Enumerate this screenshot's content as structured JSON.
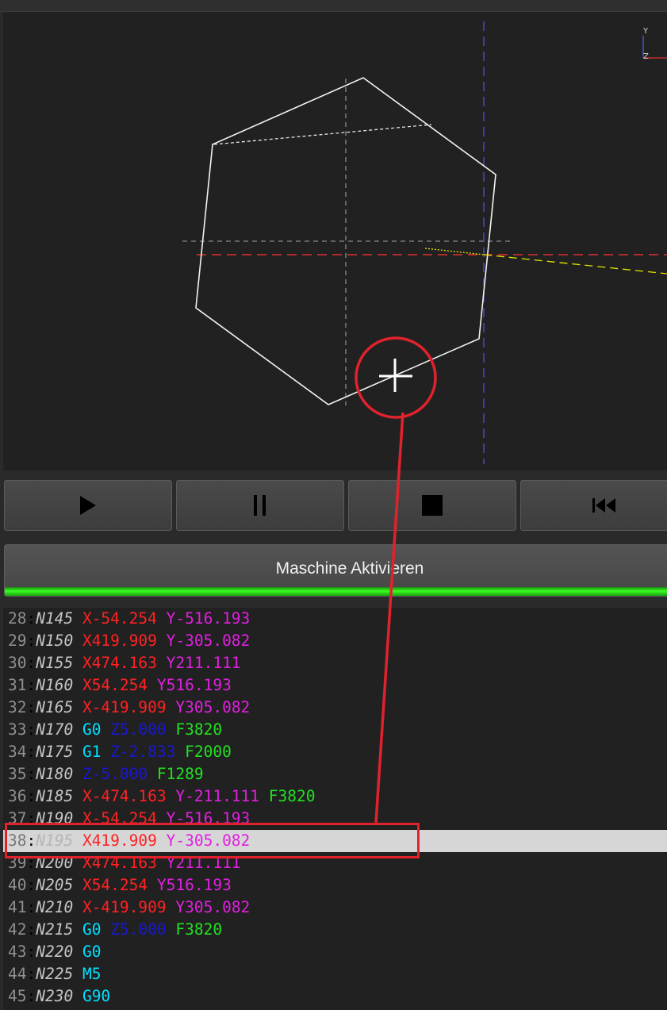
{
  "viewport": {
    "axis_y_label": "Y",
    "axis_z_label": "Z",
    "colors": {
      "hexagon": "#ffffff",
      "x_axis": "#e03030",
      "y_axis": "#4040c0",
      "toolpath": "#e6e600",
      "background": "#212121"
    }
  },
  "toolbar": {
    "buttons": [
      {
        "name": "play-button",
        "icon": "play-icon"
      },
      {
        "name": "pause-button",
        "icon": "pause-icon"
      },
      {
        "name": "stop-button",
        "icon": "stop-icon"
      },
      {
        "name": "rewind-button",
        "icon": "skip-to-start-icon"
      }
    ]
  },
  "machine": {
    "button_label": "Maschine Aktivieren",
    "status_color": "#39ff22"
  },
  "colors": {
    "X": "#ff2222",
    "Y": "#e020e0",
    "Z": "#1818d0",
    "G": "#00e0ff",
    "M": "#00e0ff",
    "F": "#22e022"
  },
  "code_lines": [
    {
      "num": "28",
      "n": "N145",
      "tokens": [
        "X-54.254",
        "Y-516.193"
      ]
    },
    {
      "num": "29",
      "n": "N150",
      "tokens": [
        "X419.909",
        "Y-305.082"
      ]
    },
    {
      "num": "30",
      "n": "N155",
      "tokens": [
        "X474.163",
        "Y211.111"
      ]
    },
    {
      "num": "31",
      "n": "N160",
      "tokens": [
        "X54.254",
        "Y516.193"
      ]
    },
    {
      "num": "32",
      "n": "N165",
      "tokens": [
        "X-419.909",
        "Y305.082"
      ]
    },
    {
      "num": "33",
      "n": "N170",
      "tokens": [
        "G0",
        "Z5.000",
        "F3820"
      ]
    },
    {
      "num": "34",
      "n": "N175",
      "tokens": [
        "G1",
        "Z-2.833",
        "F2000"
      ]
    },
    {
      "num": "35",
      "n": "N180",
      "tokens": [
        "Z-5.000",
        "F1289"
      ]
    },
    {
      "num": "36",
      "n": "N185",
      "tokens": [
        "X-474.163",
        "Y-211.111",
        "F3820"
      ]
    },
    {
      "num": "37",
      "n": "N190",
      "tokens": [
        "X-54.254",
        "Y-516.193"
      ]
    },
    {
      "num": "38",
      "n": "N195",
      "tokens": [
        "X419.909",
        "Y-305.082"
      ],
      "current": true
    },
    {
      "num": "39",
      "n": "N200",
      "tokens": [
        "X474.163",
        "Y211.111"
      ]
    },
    {
      "num": "40",
      "n": "N205",
      "tokens": [
        "X54.254",
        "Y516.193"
      ]
    },
    {
      "num": "41",
      "n": "N210",
      "tokens": [
        "X-419.909",
        "Y305.082"
      ]
    },
    {
      "num": "42",
      "n": "N215",
      "tokens": [
        "G0",
        "Z5.000",
        "F3820"
      ]
    },
    {
      "num": "43",
      "n": "N220",
      "tokens": [
        "G0"
      ]
    },
    {
      "num": "44",
      "n": "N225",
      "tokens": [
        "M5"
      ]
    },
    {
      "num": "45",
      "n": "N230",
      "tokens": [
        "G90"
      ]
    }
  ]
}
